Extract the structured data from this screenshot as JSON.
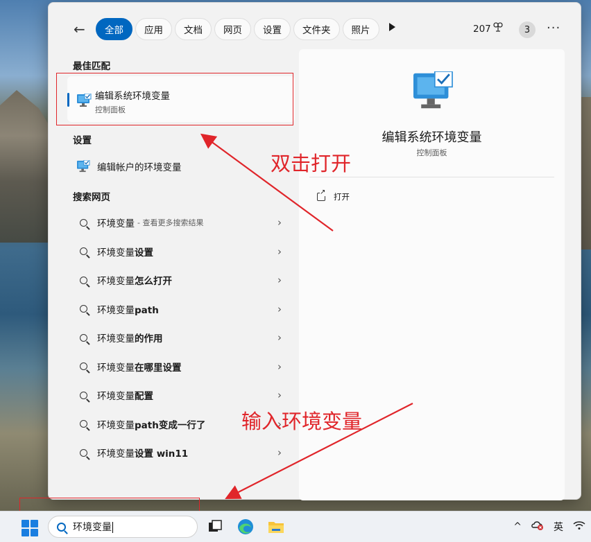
{
  "toolbar": {
    "tabs": [
      {
        "label": "全部",
        "active": true
      },
      {
        "label": "应用",
        "active": false
      },
      {
        "label": "文档",
        "active": false
      },
      {
        "label": "网页",
        "active": false
      },
      {
        "label": "设置",
        "active": false
      },
      {
        "label": "文件夹",
        "active": false
      },
      {
        "label": "照片",
        "active": false
      }
    ],
    "points": "207",
    "notifications": "3",
    "accent_color": "#0067c0"
  },
  "best_match": {
    "heading": "最佳匹配",
    "title": "编辑系统环境变量",
    "subtitle": "控制面板"
  },
  "settings": {
    "heading": "设置",
    "items": [
      {
        "label": "编辑帐户的环境变量"
      }
    ]
  },
  "web": {
    "heading": "搜索网页",
    "items": [
      {
        "query": "环境变量",
        "bold": "",
        "hint": "- 查看更多搜索结果"
      },
      {
        "query": "环境变量",
        "bold": "设置",
        "hint": ""
      },
      {
        "query": "环境变量",
        "bold": "怎么打开",
        "hint": ""
      },
      {
        "query": "环境变量",
        "bold": "path",
        "hint": ""
      },
      {
        "query": "环境变量",
        "bold": "的作用",
        "hint": ""
      },
      {
        "query": "环境变量",
        "bold": "在哪里设置",
        "hint": ""
      },
      {
        "query": "环境变量",
        "bold": "配置",
        "hint": ""
      },
      {
        "query": "环境变量",
        "bold": "path变成一行了",
        "hint": ""
      },
      {
        "query": "环境变量",
        "bold": "设置 win11",
        "hint": ""
      }
    ]
  },
  "detail": {
    "title": "编辑系统环境变量",
    "subtitle": "控制面板",
    "actions": [
      {
        "label": "打开"
      }
    ]
  },
  "annotations": {
    "double_click": "双击打开",
    "type_input": "输入环境变量",
    "color": "#e0252a"
  },
  "taskbar": {
    "search_value": "环境变量",
    "ime": "英"
  }
}
